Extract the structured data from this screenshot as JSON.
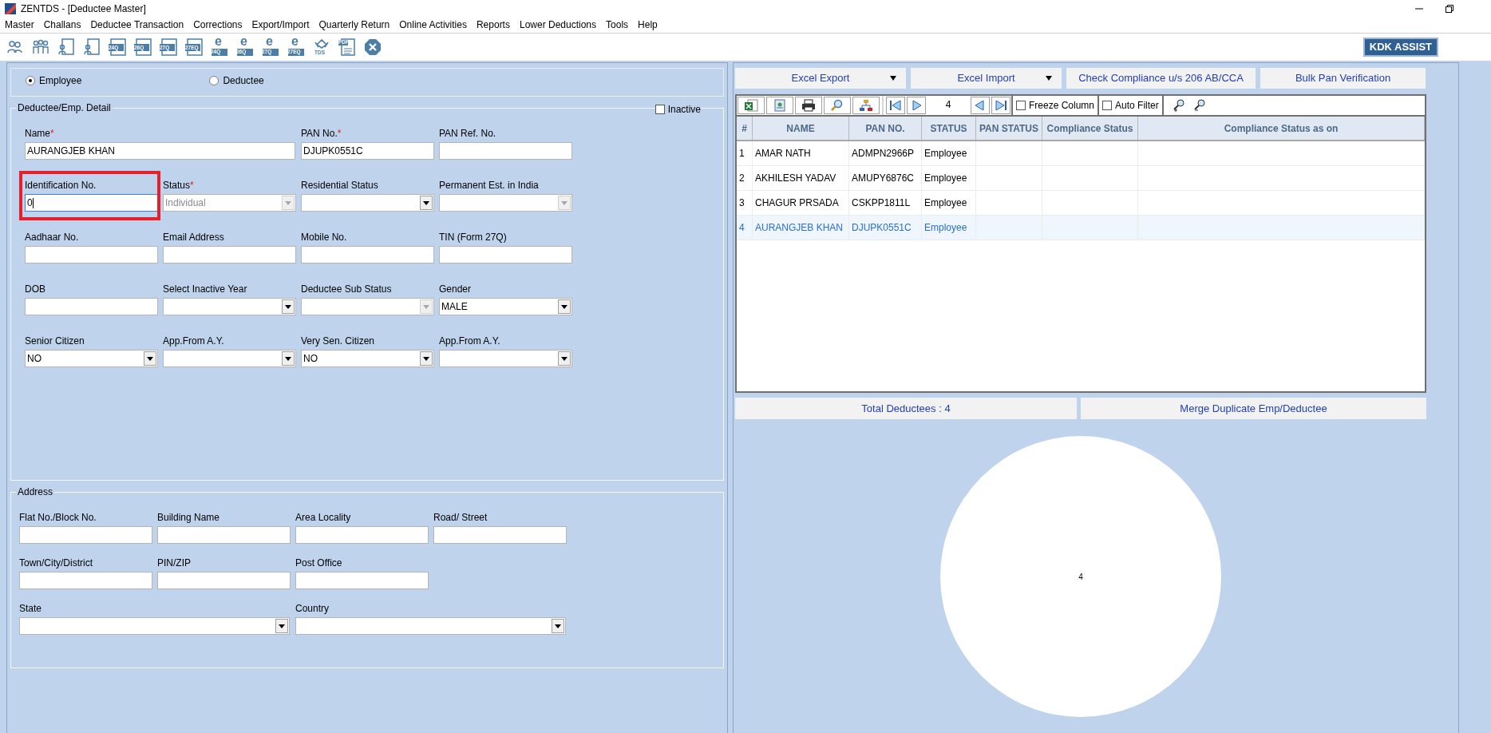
{
  "window": {
    "title": "ZENTDS - [Deductee Master]"
  },
  "menu": [
    "Master",
    "Challans",
    "Deductee Transaction",
    "Corrections",
    "Export/Import",
    "Quarterly Return",
    "Online Activities",
    "Reports",
    "Lower Deductions",
    "Tools",
    "Help"
  ],
  "toolbar": [
    {
      "kind": "users"
    },
    {
      "kind": "group"
    },
    {
      "kind": "person-doc"
    },
    {
      "kind": "person-doc"
    },
    {
      "kind": "form",
      "label": "24Q"
    },
    {
      "kind": "form",
      "label": "26Q"
    },
    {
      "kind": "form",
      "label": "27Q"
    },
    {
      "kind": "form",
      "label": "27EQ"
    },
    {
      "kind": "eform",
      "glyph": "e",
      "label": "24Q"
    },
    {
      "kind": "eform",
      "glyph": "e",
      "label": "26Q"
    },
    {
      "kind": "eform",
      "glyph": "e",
      "label": "27Q"
    },
    {
      "kind": "eform",
      "glyph": "e",
      "label": "27EQ"
    },
    {
      "kind": "tds",
      "label": "TDS"
    },
    {
      "kind": "pdf",
      "label": "PDF"
    },
    {
      "kind": "close"
    }
  ],
  "assist_button": "KDK ASSIST",
  "type_options": [
    {
      "label": "Employee",
      "selected": true
    },
    {
      "label": "Deductee",
      "selected": false
    }
  ],
  "detail": {
    "title": "Deductee/Emp. Detail",
    "inactive": {
      "label": "Inactive",
      "checked": false
    },
    "fields": [
      {
        "label": "Name",
        "required_mark": "*",
        "kind": "wide-text",
        "value": "AURANGJEB KHAN",
        "focused": false
      },
      {
        "label": "PAN No.",
        "required_mark": "*",
        "kind": "text",
        "value": "DJUPK0551C",
        "focused": false
      },
      {
        "label": "PAN Ref. No.",
        "kind": "text",
        "focused": false
      },
      {
        "label": "Identification No.",
        "kind": "text",
        "value": "0",
        "focused": true
      },
      {
        "label": "Status",
        "required_mark": "*",
        "kind": "select",
        "value": "Individual",
        "disabled": true,
        "focused": false
      },
      {
        "label": "Residential Status",
        "kind": "select",
        "disabled": false,
        "focused": false
      },
      {
        "label": "Permanent Est. in India",
        "kind": "select",
        "disabled": true,
        "focused": false
      },
      {
        "label": "Aadhaar No.",
        "kind": "text",
        "focused": false
      },
      {
        "label": "Email Address",
        "kind": "text",
        "focused": false
      },
      {
        "label": "Mobile No.",
        "kind": "text",
        "focused": false
      },
      {
        "label": "TIN (Form 27Q)",
        "kind": "text",
        "focused": false
      },
      {
        "label": "DOB",
        "kind": "text",
        "focused": false
      },
      {
        "label": "Select Inactive Year",
        "kind": "select",
        "disabled": false,
        "focused": false
      },
      {
        "label": "Deductee Sub Status",
        "kind": "select",
        "disabled": true,
        "focused": false
      },
      {
        "label": "Gender",
        "kind": "select",
        "value": "MALE",
        "disabled": false,
        "focused": false
      },
      {
        "label": "Senior Citizen",
        "kind": "select",
        "value": "NO",
        "disabled": false,
        "focused": false
      },
      {
        "label": "App.From A.Y.",
        "kind": "select",
        "disabled": false,
        "focused": false
      },
      {
        "label": "Very Sen. Citizen",
        "kind": "select",
        "value": "NO",
        "disabled": false,
        "focused": false
      },
      {
        "label": "App.From A.Y.",
        "kind": "select",
        "disabled": false,
        "focused": false
      }
    ]
  },
  "address": {
    "title": "Address",
    "fields": [
      {
        "label": "Flat No./Block No.",
        "kind": "text",
        "focused": false
      },
      {
        "label": "Building Name",
        "kind": "text",
        "focused": false
      },
      {
        "label": "Area Locality",
        "kind": "text",
        "focused": false
      },
      {
        "label": "Road/ Street",
        "kind": "text",
        "focused": false
      },
      {
        "label": "Town/City/District",
        "kind": "text",
        "focused": false
      },
      {
        "label": "PIN/ZIP",
        "kind": "text",
        "focused": false
      },
      {
        "label": "Post Office",
        "kind": "text",
        "focused": false
      },
      {
        "kind": "gap"
      },
      {
        "label": "State",
        "kind": "wide-select",
        "disabled": false,
        "focused": false
      },
      {
        "label": "Country",
        "kind": "wide-select",
        "disabled": false,
        "focused": false
      }
    ]
  },
  "actions": [
    {
      "label": "Excel Export",
      "dropdown": true
    },
    {
      "label": "Excel Import",
      "dropdown": true
    },
    {
      "label": "Check Compliance u/s 206 AB/CCA",
      "dropdown": false
    },
    {
      "label": "Bulk Pan Verification",
      "dropdown": false
    }
  ],
  "grid_toolbar": {
    "page": "4",
    "freeze_column": {
      "label": "Freeze Column",
      "checked": false
    },
    "auto_filter": {
      "label": "Auto Filter",
      "checked": false
    }
  },
  "table": {
    "columns": [
      "#",
      "NAME",
      "PAN NO.",
      "STATUS",
      "PAN STATUS",
      "Compliance Status",
      "Compliance Status as on"
    ],
    "rows": [
      {
        "cells": [
          "1",
          "AMAR NATH",
          "ADMPN2966P",
          "Employee"
        ],
        "selected": false
      },
      {
        "cells": [
          "2",
          "AKHILESH YADAV",
          "AMUPY6876C",
          "Employee"
        ],
        "selected": false
      },
      {
        "cells": [
          "3",
          "CHAGUR PRSADA",
          "CSKPP1811L",
          "Employee"
        ],
        "selected": false
      },
      {
        "cells": [
          "4",
          "AURANGJEB KHAN",
          "DJUPK0551C",
          "Employee"
        ],
        "selected": true
      }
    ]
  },
  "footer_buttons": [
    "Total Deductees : 4",
    "Merge Duplicate Emp/Deductee"
  ],
  "chart": {
    "chart_data": {
      "type": "pie",
      "values": [
        4
      ],
      "data_labels": true
    }
  }
}
